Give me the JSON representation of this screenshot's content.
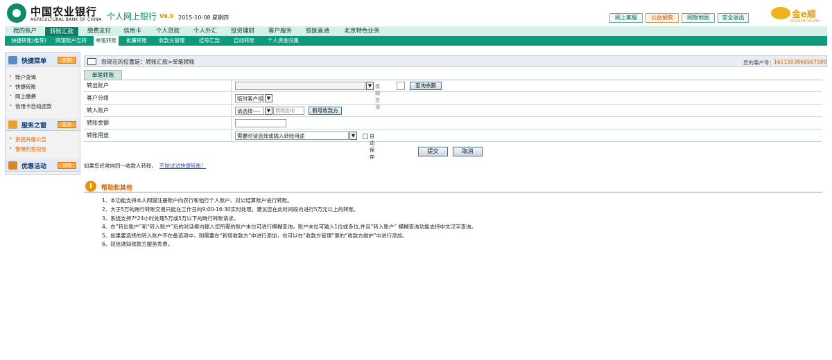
{
  "header": {
    "bank_name_cn": "中国农业银行",
    "bank_name_en": "AGRICULTURAL BANK OF CHINA",
    "app_title": "个人网上银行",
    "app_version": "V6.0",
    "date": "2015-10-08 星期四",
    "buttons": [
      "网上客服",
      "公益捐款",
      "网银地图",
      "安全退出"
    ],
    "partner_logo_text": "金e顺",
    "partner_logo_sub": "GOLDEN ONLINE"
  },
  "nav_primary": [
    "我的账户",
    "转账汇款",
    "缴费支付",
    "信用卡",
    "个人贷款",
    "个人外汇",
    "投资理财",
    "客户服务",
    "银医直通",
    "北京特色业务"
  ],
  "nav_primary_active": "转账汇款",
  "nav_secondary": [
    "快捷转账(推荐)",
    "网银账户互转",
    "单笔转账",
    "批量转账",
    "收款方管理",
    "挂号汇款",
    "自动转账",
    "个人资金归集"
  ],
  "nav_secondary_active": "单笔转账",
  "sidebar": {
    "quick_menu": {
      "title": "快捷菜单",
      "button": "定制",
      "items": [
        "账户查询",
        "快捷转账",
        "网上缴费",
        "信用卡自动还款"
      ]
    },
    "service": {
      "title": "服务之窗",
      "button": "更多",
      "items": [
        "系统升级公告",
        "警惕钓鱼短信"
      ]
    },
    "promo": {
      "title": "优惠活动",
      "button": "详情"
    }
  },
  "breadcrumb": {
    "text": "您现在的位置是：转账汇款>单笔转账",
    "customer_label": "您的客户号：",
    "customer_number": "1611503866567589"
  },
  "form": {
    "tab": "单笔转账",
    "rows": {
      "from_account": {
        "label": "转出账户",
        "hint": "模糊查询",
        "button": "查询余额"
      },
      "customer_group": {
        "label": "客户分组",
        "value": "临时客户组"
      },
      "to_account": {
        "label": "转入账户",
        "value": "请选择----",
        "hint": "模糊查询",
        "button": "新增收款方"
      },
      "amount": {
        "label": "转账金额",
        "value": ""
      },
      "purpose": {
        "label": "转账用途",
        "value": "需要时请选择或输入转账用途",
        "checkbox_label": "自动保存"
      }
    },
    "submit": "提交",
    "cancel": "取消"
  },
  "frequent": {
    "text": "如果您经常向同一收款人转账，",
    "link": "不妨试试快捷转账！"
  },
  "help": {
    "title": "帮助和其他",
    "lines": [
      "1、本功能支持本人网银注册账户向农行和他行个人账户、对公结算账户进行转账。",
      "2、大于5万的跨行转账交易只能在工作日的9:00-16:30实时处理，建议您在此时间段内进行5万元以上的转账。",
      "3、系统支持7*24小时处理5万或5万以下的跨行转账请求。",
      "4、在“转出账户”和“转入账户”后的对话框内输入您所需的账户末位可进行模糊查询，账户末位可输入1位或多位,并且“转入账户” 模糊查询功能支持中文汉字查询。",
      "5、如果要选择的转入账户不在备选项中，则需要在“新增收款方”中进行添加，也可以在“收款方管理”里的“收款方维护”中进行添加。",
      "6、短信通知收款方服务免费。"
    ]
  }
}
